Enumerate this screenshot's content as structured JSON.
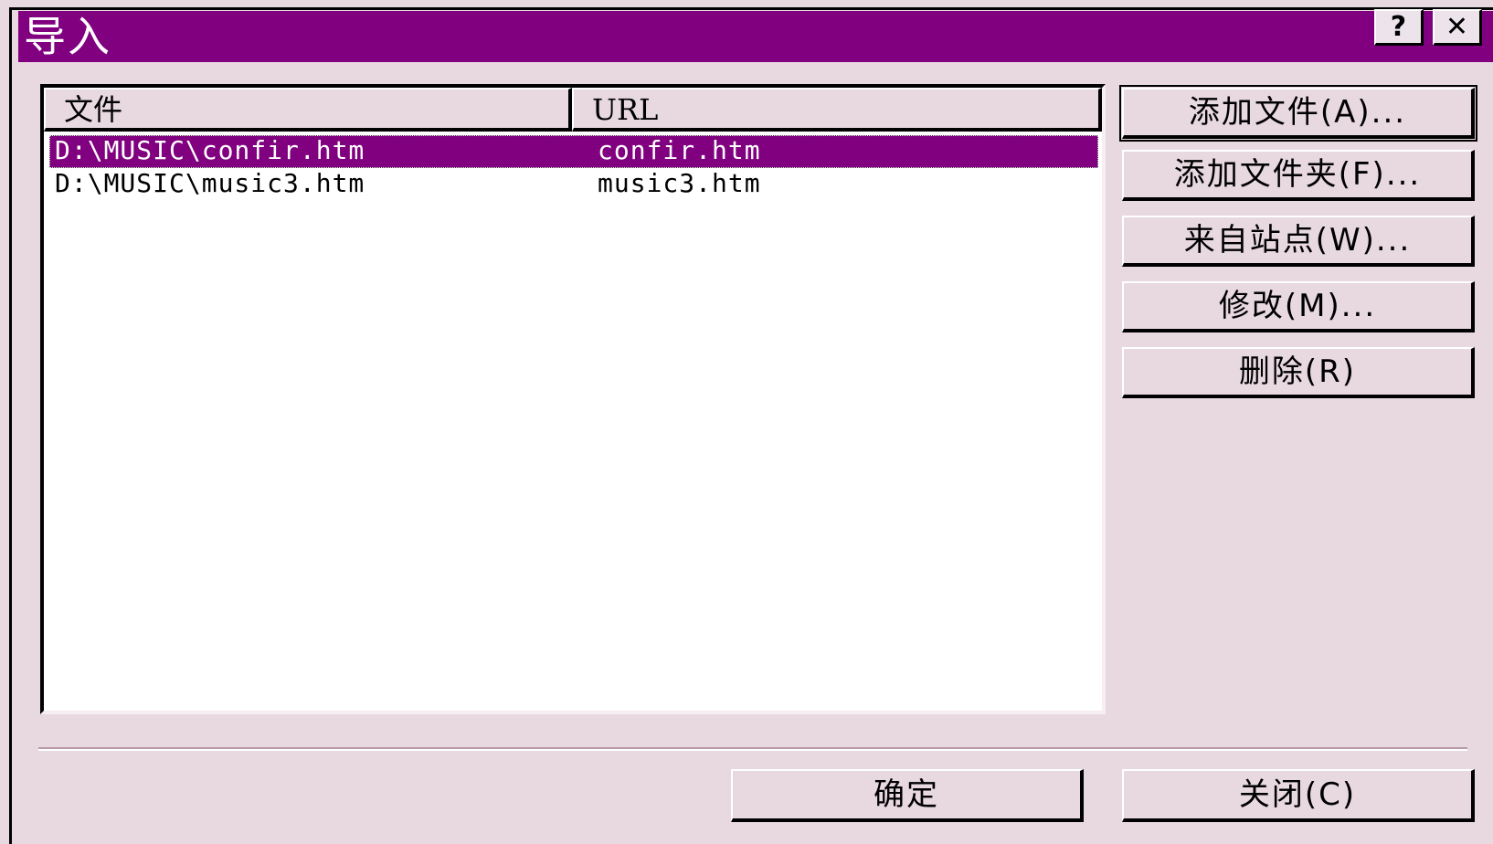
{
  "window": {
    "title": "导入",
    "help_label": "?",
    "close_label": "✕"
  },
  "list": {
    "columns": [
      "文件",
      "URL"
    ],
    "rows": [
      {
        "file": "D:\\MUSIC\\confir.htm",
        "url": "confir.htm",
        "selected": true
      },
      {
        "file": "D:\\MUSIC\\music3.htm",
        "url": "music3.htm",
        "selected": false
      }
    ]
  },
  "actions": {
    "add_file": "添加文件(A)...",
    "add_folder": "添加文件夹(F)...",
    "from_site": "来自站点(W)...",
    "modify": "修改(M)...",
    "delete": "删除(R)"
  },
  "footer": {
    "ok": "确定",
    "close": "关闭(C)"
  },
  "colors": {
    "title_bar": "#800080",
    "selection": "#800080",
    "dialog_bg": "#e8d8e0"
  }
}
